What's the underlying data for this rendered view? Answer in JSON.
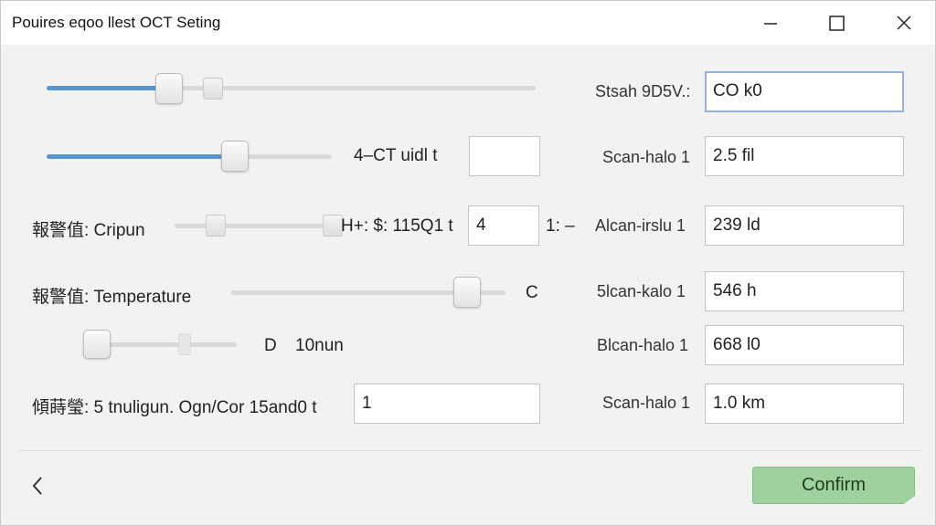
{
  "window": {
    "title": "Pouires eqoo llest OCT Seting"
  },
  "left": {
    "row2_label": "4–CT uidl t",
    "row3_prefix": "報警值: Cripun",
    "row3_readout": "H+: $: 115Q1 t",
    "row3_value": "4",
    "row3_suffix": "1: –",
    "row4_label": "報警值: Temperature",
    "row4_unit": "C",
    "row5_unit": "D",
    "row5_value": "10nun",
    "row6_label": "傾蒔瑩: 5 tnuligun. Ogn/Cor 15and0 t",
    "row6_value": "1"
  },
  "sliders": {
    "s1_level": 0.25,
    "s2_level": 0.66,
    "s4_level": 0.86,
    "s5_level": 0.0
  },
  "right": {
    "rows": [
      {
        "label": "Stsah 9D5V.:",
        "value": "CO k0"
      },
      {
        "label": "Scan-halo 1",
        "value": "2.5 fil"
      },
      {
        "label": "Alcan-irslu 1",
        "value": "239 ld"
      },
      {
        "label": "5lcan-kalo 1",
        "value": "546 h"
      },
      {
        "label": "Blcan-halo 1",
        "value": "668 l0"
      },
      {
        "label": "Scan-halo 1",
        "value": "1.0 km"
      }
    ]
  },
  "footer": {
    "confirm_label": "Confirm"
  },
  "icons": {
    "minimize": "minimize-icon",
    "maximize": "maximize-icon",
    "close": "close-icon",
    "back": "chevron-left-icon"
  },
  "colors": {
    "slider_fill": "#5b93cc",
    "confirm_bg": "#9ed19d",
    "field_focus": "#8fb4e0"
  }
}
